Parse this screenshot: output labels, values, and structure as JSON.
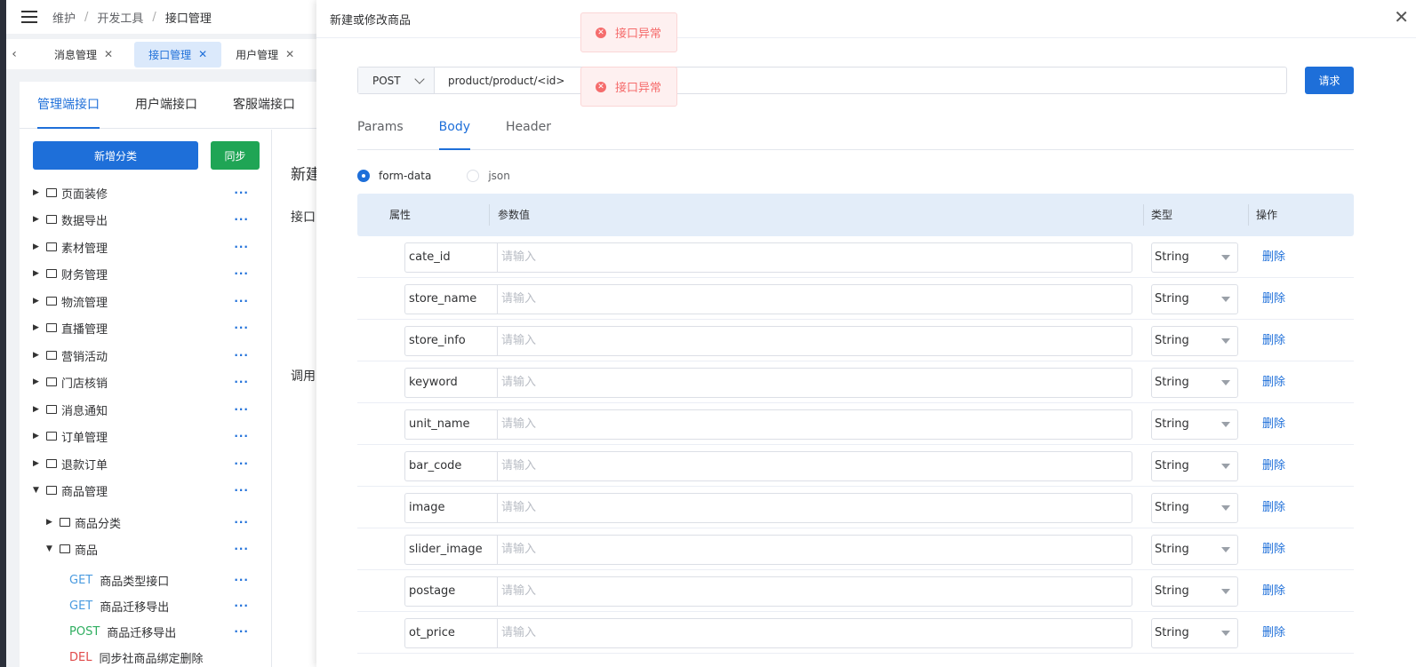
{
  "breadcrumb": [
    "维护",
    "开发工具",
    "接口管理"
  ],
  "page_tabs": [
    {
      "label": "消息管理",
      "active": false
    },
    {
      "label": "接口管理",
      "active": true
    },
    {
      "label": "用户管理",
      "active": false
    }
  ],
  "api_tabs": [
    {
      "label": "管理端接口",
      "active": true
    },
    {
      "label": "用户端接口",
      "active": false
    },
    {
      "label": "客服端接口",
      "active": false
    }
  ],
  "tree": {
    "add_category_label": "新增分类",
    "sync_label": "同步",
    "items": [
      {
        "label": "页面装修",
        "expanded": false,
        "level": 1
      },
      {
        "label": "数据导出",
        "expanded": false,
        "level": 1
      },
      {
        "label": "素材管理",
        "expanded": false,
        "level": 1
      },
      {
        "label": "财务管理",
        "expanded": false,
        "level": 1
      },
      {
        "label": "物流管理",
        "expanded": false,
        "level": 1
      },
      {
        "label": "直播管理",
        "expanded": false,
        "level": 1
      },
      {
        "label": "营销活动",
        "expanded": false,
        "level": 1
      },
      {
        "label": "门店核销",
        "expanded": false,
        "level": 1
      },
      {
        "label": "消息通知",
        "expanded": false,
        "level": 1
      },
      {
        "label": "订单管理",
        "expanded": false,
        "level": 1
      },
      {
        "label": "退款订单",
        "expanded": false,
        "level": 1
      },
      {
        "label": "商品管理",
        "expanded": true,
        "level": 1
      },
      {
        "label": "商品分类",
        "expanded": false,
        "level": 2
      },
      {
        "label": "商品",
        "expanded": true,
        "level": 2
      }
    ],
    "endpoints": [
      {
        "method": "GET",
        "label": "商品类型接口"
      },
      {
        "method": "GET",
        "label": "商品迁移导出"
      },
      {
        "method": "POST",
        "label": "商品迁移导出"
      },
      {
        "method": "DEL",
        "label": "同步社商品绑定删除"
      }
    ],
    "partial_texts": [
      "新建",
      "接口",
      "调用"
    ]
  },
  "drawer": {
    "title": "新建或修改商品",
    "method": "POST",
    "url": "product/product/<id>",
    "request_label": "请求",
    "tabs": [
      {
        "label": "Params",
        "active": false
      },
      {
        "label": "Body",
        "active": true
      },
      {
        "label": "Header",
        "active": false
      }
    ],
    "radio_options": [
      {
        "label": "form-data",
        "checked": true
      },
      {
        "label": "json",
        "checked": false
      }
    ],
    "columns": [
      "属性",
      "参数值",
      "类型",
      "操作"
    ],
    "value_placeholder": "请输入",
    "delete_label": "删除",
    "rows": [
      {
        "name": "cate_id",
        "type": "String"
      },
      {
        "name": "store_name",
        "type": "String"
      },
      {
        "name": "store_info",
        "type": "String"
      },
      {
        "name": "keyword",
        "type": "String"
      },
      {
        "name": "unit_name",
        "type": "String"
      },
      {
        "name": "bar_code",
        "type": "String"
      },
      {
        "name": "image",
        "type": "String"
      },
      {
        "name": "slider_image",
        "type": "String"
      },
      {
        "name": "postage",
        "type": "String"
      },
      {
        "name": "ot_price",
        "type": "String"
      }
    ]
  },
  "toasts": [
    "接口异常",
    "接口异常"
  ],
  "colors": {
    "primary": "#1e6fd9",
    "success": "#1fa555",
    "error": "#f56c6c"
  }
}
